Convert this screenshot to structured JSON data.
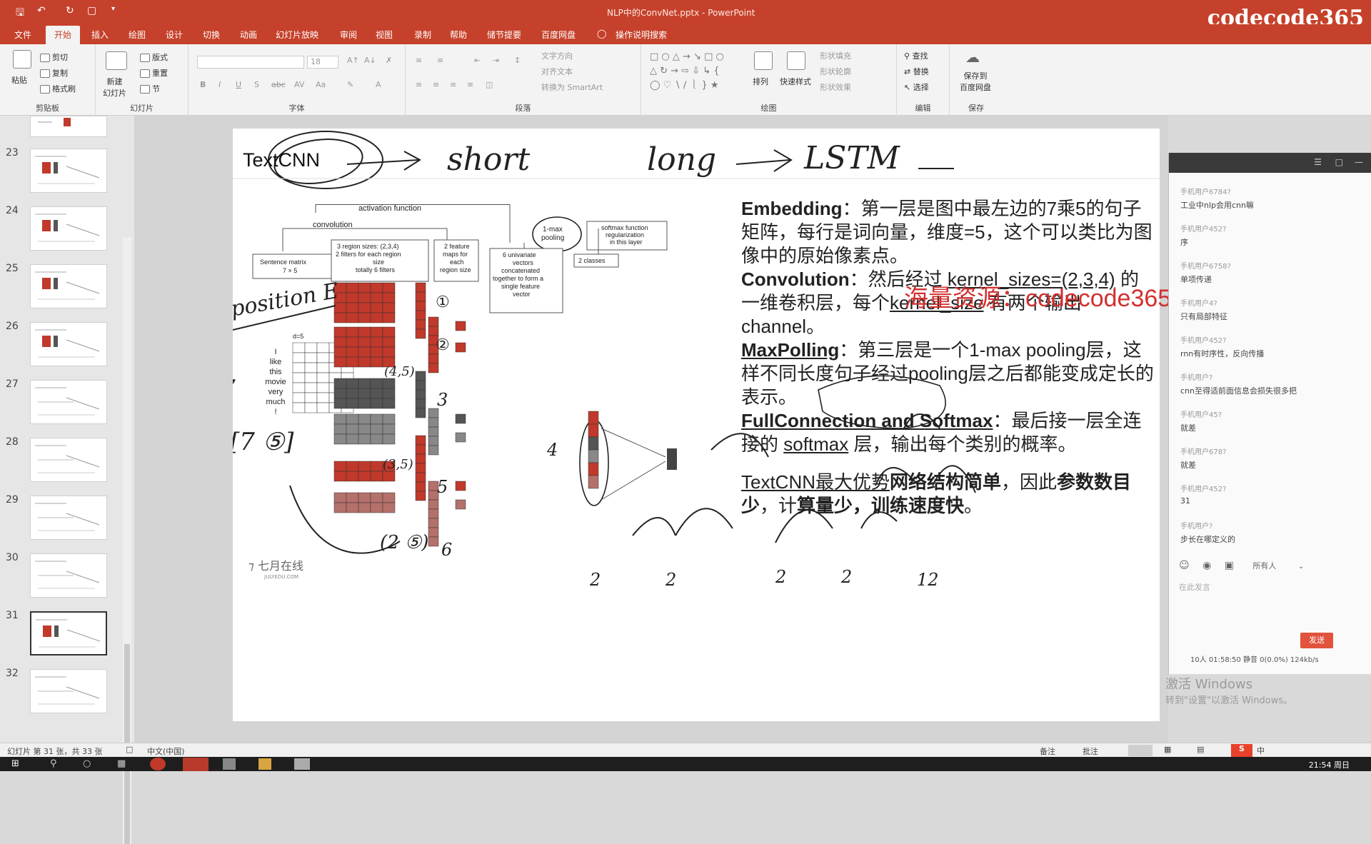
{
  "title_bar": {
    "doc_title": "NLP中的ConvNet.pptx  -  PowerPoint",
    "watermark": "codecode365"
  },
  "tabs": [
    "文件",
    "开始",
    "插入",
    "绘图",
    "设计",
    "切换",
    "动画",
    "幻灯片放映",
    "审阅",
    "视图",
    "录制",
    "帮助",
    "储节提要",
    "百度网盘",
    "操作说明搜索"
  ],
  "active_tab": "开始",
  "ribbon": {
    "clipboard": {
      "paste": "粘贴",
      "cut": "剪切",
      "copy": "复制",
      "format_painter": "格式刷",
      "label": "剪贴板"
    },
    "slides": {
      "new_slide": "新建\n幻灯片",
      "layout": "版式",
      "reset": "重置",
      "section": "节",
      "label": "幻灯片"
    },
    "font": {
      "label": "字体",
      "size": "18"
    },
    "paragraph": {
      "text_direction": "文字方向",
      "align_text": "对齐文本",
      "smartart": "转换为 SmartArt",
      "label": "段落"
    },
    "drawing": {
      "arrange": "排列",
      "quick_styles": "快速样式",
      "shape_fill": "形状填充",
      "shape_outline": "形状轮廓",
      "shape_effects": "形状效果",
      "label": "绘图"
    },
    "editing": {
      "find": "查找",
      "replace": "替换",
      "select": "选择",
      "label": "编辑"
    },
    "save": {
      "save_to": "保存到\n百度网盘",
      "label": "保存"
    }
  },
  "thumbnails": [
    {
      "num": "23"
    },
    {
      "num": "24"
    },
    {
      "num": "25"
    },
    {
      "num": "26"
    },
    {
      "num": "27"
    },
    {
      "num": "28"
    },
    {
      "num": "29"
    },
    {
      "num": "30"
    },
    {
      "num": "31",
      "selected": true
    },
    {
      "num": "32"
    }
  ],
  "slide": {
    "title": "TextCNN",
    "handwriting": {
      "arrow_text1": "short",
      "arrow_text2": "long",
      "arrow_text3": "LSTM",
      "position": "position E",
      "seven": "7",
      "bracket": "[7 ⑤]",
      "n45": "(4,5)",
      "n35": "(3,5)",
      "n25": "(2 ⑤)",
      "n3": "3",
      "n4": "4",
      "n5": "5",
      "n6": "6",
      "c1": "①",
      "c2": "②",
      "numbers": [
        "2",
        "2",
        "2",
        "12"
      ]
    },
    "diagram": {
      "activation_function": "activation function",
      "convolution": "convolution",
      "one_max_pooling": "1-max\npooling",
      "softmax_note": "softmax function\nregularization\nin this layer",
      "sentence_matrix": "Sentence matrix\n7 × 5",
      "region_sizes": "3 region sizes: (2,3,4)\n2 filters for each region\nsize\ntotally 6 filters",
      "feature_maps": "2 feature\nmaps for\neach\nregion size",
      "univariate": "6 univariate\nvectors\nconcatenated\ntogether to form a\nsingle feature\nvector",
      "two_classes": "2 classes",
      "d5": "d=5",
      "words": [
        "I",
        "like",
        "this",
        "movie",
        "very",
        "much",
        "!"
      ],
      "logo_text": "七月在线",
      "logo_sub": "JULYEDU.COM"
    },
    "text": {
      "embedding_key": "Embedding",
      "embedding_body": "：第一层是图中最左边的7乘5的句子矩阵，每行是词向量，维度=5，这个可以类比为图像中的原始像素点。",
      "convolution_key": "Convolution",
      "convolution_body1": "：然后经过 ",
      "kernel_sizes": "kernel_sizes=(2,3,4)",
      "convolution_body2": " 的一维卷积层，每个",
      "kernel_size": "kernel_size",
      "convolution_body3": " 有两个输出 channel。",
      "maxpool_key": "MaxPolling",
      "maxpool_body": "：第三层是一个1-max pooling层，这样不同长度句子经过pooling层之后都能变成定长的表示。",
      "fc_key": "FullConnection and Softmax",
      "fc_body1": "：最后接一层全连接的 ",
      "softmax": "softmax",
      "fc_body2": " 层，输出每个类别的概率。",
      "adv1": "TextCNN最大优势",
      "adv2": "网络结构简单",
      "adv3": "，因此",
      "adv4": "参数数目少",
      "adv5": "，计",
      "adv6": "算量少，训练速度快",
      "adv7": "。"
    },
    "overlay_watermark": "海量资源：codecode365"
  },
  "chat": {
    "messages": [
      {
        "user": "手机用户6784?",
        "text": "工业中nlp会用cnn嘛"
      },
      {
        "user": "手机用户452?",
        "text": "序"
      },
      {
        "user": "手机用户6758?",
        "text": "单项传递"
      },
      {
        "user": "手机用户4?",
        "text": "只有局部特征"
      },
      {
        "user": "手机用户452?",
        "text": "rnn有时序性，反向传播"
      },
      {
        "user": "手机用户?",
        "text": "cnn至得适前面信息会损失很多把"
      },
      {
        "user": "手机用户45?",
        "text": "就差"
      },
      {
        "user": "手机用户678?",
        "text": "就差"
      },
      {
        "user": "手机用户452?",
        "text": "31"
      },
      {
        "user": "手机用户?",
        "text": "步长在哪定义的"
      }
    ],
    "recipient": "所有人",
    "input_placeholder": "在此发言",
    "send": "发送",
    "stats": "10人   01:58:50   静音   0(0.0%)  124kb/s"
  },
  "status_bar": {
    "slide_info": "幻灯片 第 31 张，共 33 张",
    "language": "中文(中国)",
    "notes": "备注",
    "comments": "批注"
  },
  "activate_windows": {
    "line1": "激活 Windows",
    "line2": "转到\"设置\"以激活 Windows。"
  },
  "taskbar": {
    "time": "21:54 周日",
    "ime": "中"
  },
  "colors": {
    "brand": "#c6412b",
    "cell_red": "#c0392b",
    "overlay_red": "#d32f2f"
  }
}
